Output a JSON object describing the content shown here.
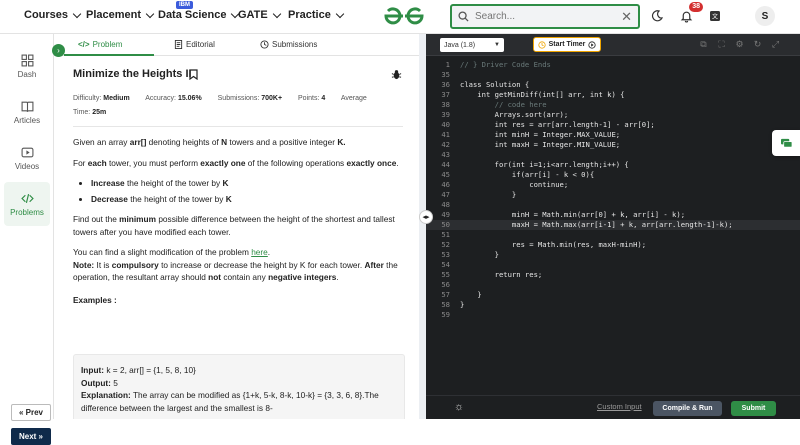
{
  "nav": {
    "items": [
      "Courses",
      "Placement",
      "Data Science",
      "GATE",
      "Practice"
    ],
    "ibm_badge": "IBM",
    "search_placeholder": "Search...",
    "notification_count": "38",
    "avatar_initial": "S",
    "brand_color": "#2f8d46"
  },
  "sidebar": {
    "items": [
      {
        "label": "Dash",
        "icon": "dashboard-icon"
      },
      {
        "label": "Articles",
        "icon": "book-icon"
      },
      {
        "label": "Videos",
        "icon": "video-icon"
      },
      {
        "label": "Problems",
        "icon": "code-icon"
      }
    ],
    "prev_label": "« Prev",
    "next_label": "Next »"
  },
  "tabs": {
    "problem": "Problem",
    "editorial": "Editorial",
    "submissions": "Submissions"
  },
  "problem": {
    "title": "Minimize the Heights II",
    "difficulty_label": "Difficulty:",
    "difficulty": "Medium",
    "accuracy_label": "Accuracy:",
    "accuracy": "15.06%",
    "submissions_label": "Submissions:",
    "submissions": "700K+",
    "points_label": "Points:",
    "points": "4",
    "average_label": "Average",
    "time_label": "Time:",
    "time": "25m",
    "p1_pre": "Given an array ",
    "p1_arr": "arr[]",
    "p1_mid": " denoting heights of ",
    "p1_n": "N",
    "p1_mid2": " towers and a positive integer ",
    "p1_k": "K.",
    "p2_pre": "For ",
    "p2_each": "each",
    "p2_mid": " tower, you must perform ",
    "p2_once": "exactly one",
    "p2_mid2": " of the following operations ",
    "p2_once2": "exactly once",
    "p2_end": ".",
    "li1_bold": "Increase",
    "li1_rest": " the height of the tower by ",
    "li1_k": "K",
    "li2_bold": "Decrease",
    "li2_rest": " the height of the tower by ",
    "li2_k": "K",
    "p3_pre": "Find out the ",
    "p3_min": "minimum",
    "p3_rest": " possible difference between the height of the shortest and tallest towers after you have modified each tower.",
    "p4_pre": "You can find a slight modification of the problem ",
    "p4_link": "here",
    "p4_end": ".",
    "note_label": "Note:",
    "note_pre": " It is ",
    "note_comp": "compulsory",
    "note_rest": " to increase or decrease the height by K for each tower. ",
    "note_after": "After",
    "note_rest2": " the operation, the resultant array should ",
    "note_not": "not",
    "note_rest3": " contain any ",
    "note_neg": "negative integers",
    "note_end": ".",
    "examples_label": "Examples :",
    "ex_input_label": "Input:",
    "ex_input": " k = 2, arr[] = {1, 5, 8, 10}",
    "ex_output_label": "Output:",
    "ex_output": " 5",
    "ex_expl_label": "Explanation:",
    "ex_expl": " The array can be modified as {1+k, 5-k, 8-k, 10-k} = {3, 3, 6, 8}.The difference between the largest and the smallest is 8-"
  },
  "editor": {
    "language": "Java (1.8)",
    "timer_label": "Start Timer",
    "custom_input": "Custom Input",
    "compile_label": "Compile & Run",
    "submit_label": "Submit",
    "lines": [
      {
        "n": "1",
        "code": "// } Driver Code Ends",
        "c": "#6a7a7a"
      },
      {
        "n": "35",
        "code": "",
        "c": "#e6e6e6"
      },
      {
        "n": "36",
        "code": "class Solution {",
        "c": "#e6e6e6"
      },
      {
        "n": "37",
        "code": "    int getMinDiff(int[] arr, int k) {",
        "c": "#e6e6e6"
      },
      {
        "n": "38",
        "code": "        // code here",
        "c": "#6a7a7a"
      },
      {
        "n": "39",
        "code": "        Arrays.sort(arr);",
        "c": "#e6e6e6"
      },
      {
        "n": "40",
        "code": "        int res = arr[arr.length-1] - arr[0];",
        "c": "#e6e6e6"
      },
      {
        "n": "41",
        "code": "        int minH = Integer.MAX_VALUE;",
        "c": "#e6e6e6"
      },
      {
        "n": "42",
        "code": "        int maxH = Integer.MIN_VALUE;",
        "c": "#e6e6e6"
      },
      {
        "n": "43",
        "code": "",
        "c": "#e6e6e6"
      },
      {
        "n": "44",
        "code": "        for(int i=1;i<arr.length;i++) {",
        "c": "#e6e6e6"
      },
      {
        "n": "45",
        "code": "            if(arr[i] - k < 0){",
        "c": "#e6e6e6"
      },
      {
        "n": "46",
        "code": "                continue;",
        "c": "#e6e6e6"
      },
      {
        "n": "47",
        "code": "            }",
        "c": "#e6e6e6"
      },
      {
        "n": "48",
        "code": "",
        "c": "#e6e6e6"
      },
      {
        "n": "49",
        "code": "            minH = Math.min(arr[0] + k, arr[i] - k);",
        "c": "#e6e6e6"
      },
      {
        "n": "50",
        "code": "            maxH = Math.max(arr[i-1] + k, arr[arr.length-1]-k);",
        "c": "#e6e6e6"
      },
      {
        "n": "51",
        "code": "",
        "c": "#e6e6e6"
      },
      {
        "n": "52",
        "code": "            res = Math.min(res, maxH-minH);",
        "c": "#e6e6e6"
      },
      {
        "n": "53",
        "code": "        }",
        "c": "#e6e6e6"
      },
      {
        "n": "54",
        "code": "",
        "c": "#e6e6e6"
      },
      {
        "n": "55",
        "code": "        return res;",
        "c": "#e6e6e6"
      },
      {
        "n": "56",
        "code": "",
        "c": "#e6e6e6"
      },
      {
        "n": "57",
        "code": "    }",
        "c": "#e6e6e6"
      },
      {
        "n": "58",
        "code": "}",
        "c": "#e6e6e6"
      },
      {
        "n": "59",
        "code": "",
        "c": "#e6e6e6"
      }
    ]
  }
}
